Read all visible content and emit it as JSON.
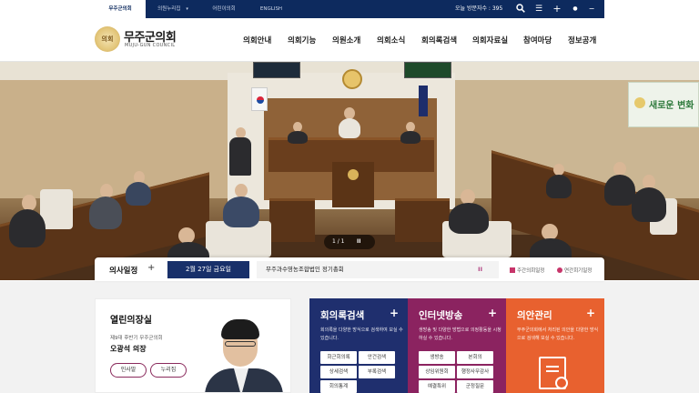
{
  "topbar": {
    "tabs": [
      {
        "label": "무주군의회"
      },
      {
        "label": "의원누리집"
      },
      {
        "label": "어린이의회"
      },
      {
        "label": "ENGLISH"
      }
    ],
    "visitor_label": "오늘 방문자수 : 395",
    "icons": [
      "search-icon",
      "menu-icon",
      "plus-icon",
      "dot-icon",
      "dash-icon"
    ]
  },
  "header": {
    "logo_emblem_text": "의회",
    "logo_title": "무주군의회",
    "logo_subtitle": "MUJU-GUN COUNCIL",
    "nav": [
      "의회안내",
      "의회기능",
      "의원소개",
      "의회소식",
      "회의록검색",
      "의회자료실",
      "참여마당",
      "정보공개"
    ]
  },
  "hero": {
    "pager": "1 / 1",
    "pause_symbol": "II",
    "banner_text": "새로운 변화"
  },
  "schedule": {
    "title": "의사일정",
    "plus": "+",
    "date": "2월 27일 금요일",
    "event": "무주과수영농조합법인 정기총회",
    "pause_symbol": "II",
    "links": [
      "주간의회일정",
      "연간회기일정"
    ]
  },
  "speaker": {
    "title": "열린의장실",
    "term": "제9대 후반기 무주군의회",
    "name": "오광석 의장",
    "buttons": [
      "인사말",
      "누리집"
    ]
  },
  "services": [
    {
      "title": "회의록검색",
      "plus": "+",
      "desc": "회의록을 다양한 방식으로 검색하여 보실 수 있습니다.",
      "color": "#1f2f6e",
      "buttons": [
        "회근회의록",
        "안건검색",
        "상세검색",
        "부록검색",
        "회의통계"
      ]
    },
    {
      "title": "인터넷방송",
      "plus": "+",
      "desc": "생방송 및 다양한 방법으로 의정활동을 시청하실 수 있습니다.",
      "color": "#8b2360",
      "buttons": [
        "생방송",
        "본회의",
        "상임위원회",
        "행정사무감사",
        "예결특위",
        "군정질문"
      ]
    },
    {
      "title": "의안관리",
      "plus": "+",
      "desc": "무주군의회에서 처리된 의안을 다양한 방식으로 검색해 보실 수 있습니다.",
      "color": "#e8612f"
    }
  ],
  "colors": {
    "navy": "#0d2a5e",
    "schedule_date_bg": "#18306a",
    "accent_magenta": "#c7356a"
  }
}
